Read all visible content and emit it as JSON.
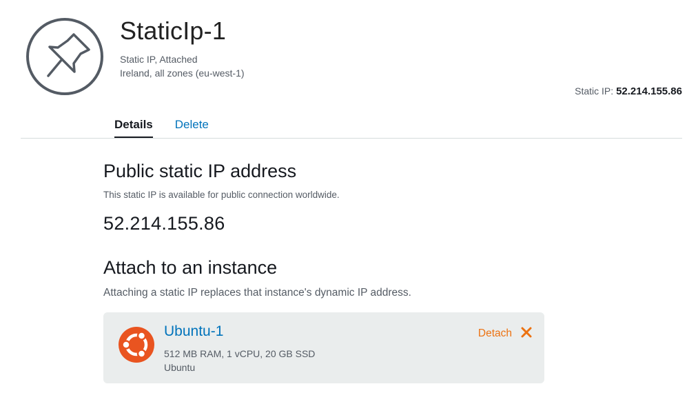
{
  "header": {
    "title": "StaticIp-1",
    "type_status": "Static IP, Attached",
    "location": "Ireland, all zones (eu-west-1)",
    "summary_label": "Static IP:",
    "summary_value": "52.214.155.86",
    "icon": "pushpin-icon"
  },
  "tabs": [
    {
      "label": "Details",
      "active": true
    },
    {
      "label": "Delete",
      "active": false
    }
  ],
  "public_ip": {
    "heading": "Public static IP address",
    "description": "This static IP is available for public connection worldwide.",
    "address": "52.214.155.86"
  },
  "attach": {
    "heading": "Attach to an instance",
    "description": "Attaching a static IP replaces that instance's dynamic IP address.",
    "instance": {
      "name": "Ubuntu-1",
      "specs": "512 MB RAM, 1 vCPU, 20 GB SSD",
      "os": "Ubuntu",
      "icon": "ubuntu-logo-icon",
      "action_label": "Detach",
      "action_icon": "close-icon"
    }
  },
  "colors": {
    "link": "#0073bb",
    "accent_orange": "#ec7211",
    "ubuntu_orange": "#e95420",
    "card_bg": "#eaeded"
  }
}
